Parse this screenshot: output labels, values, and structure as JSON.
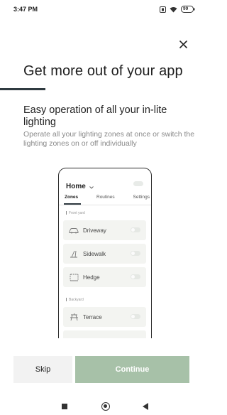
{
  "status_bar": {
    "time": "3:47 PM",
    "battery_level": "99"
  },
  "onboarding": {
    "title": "Get more out of your app",
    "subtitle": "Easy operation of all your in-lite lighting",
    "description": "Operate all your lighting zones at once or switch the lighting zones on or off individually"
  },
  "phone_mockup": {
    "home_label": "Home",
    "tabs": [
      "Zones",
      "Routines",
      "Settings"
    ],
    "active_tab": "Zones",
    "sections": [
      {
        "label": "Front yard",
        "zones": [
          {
            "label": "Driveway",
            "icon": "car-icon",
            "on": false
          },
          {
            "label": "Sidewalk",
            "icon": "path-icon",
            "on": false
          },
          {
            "label": "Hedge",
            "icon": "hedge-icon",
            "on": false
          }
        ]
      },
      {
        "label": "Backyard",
        "zones": [
          {
            "label": "Terrace",
            "icon": "table-icon",
            "on": false
          }
        ]
      }
    ]
  },
  "actions": {
    "skip_label": "Skip",
    "continue_label": "Continue"
  },
  "colors": {
    "accent": "#a7c1a8",
    "dark": "#2f3a40"
  }
}
